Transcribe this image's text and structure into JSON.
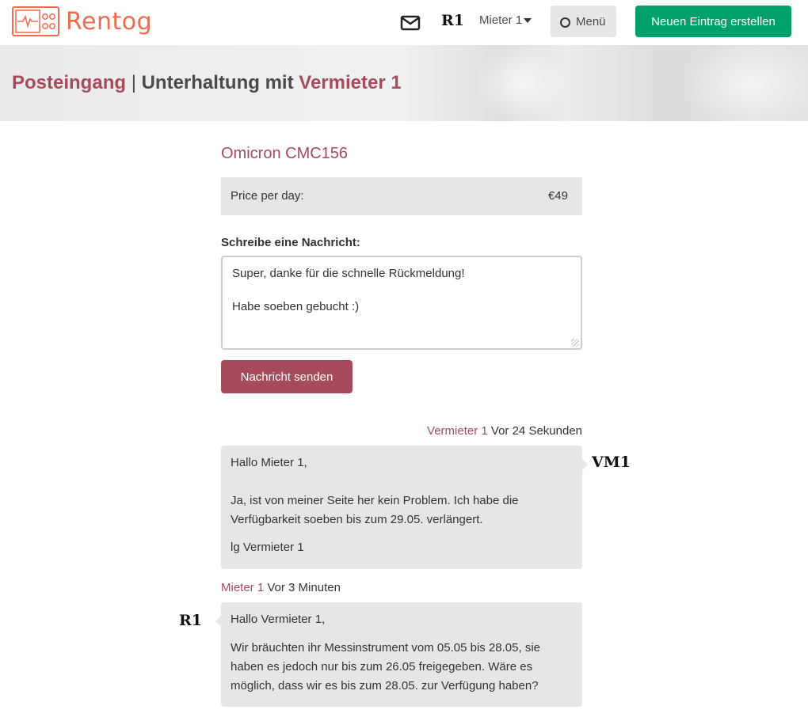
{
  "header": {
    "logo_text": "Rentog",
    "logo_icon": "monitor-pulse-icon",
    "inbox_icon": "envelope-icon",
    "user_initials": "R1",
    "user_name": "Mieter 1",
    "menu_label": "Menü",
    "create_button": "Neuen Eintrag erstellen"
  },
  "banner": {
    "inbox_link": "Posteingang",
    "separator": "|",
    "conversation_prefix": "Unterhaltung mit",
    "partner_name": "Vermieter 1"
  },
  "listing": {
    "title": "Omicron CMC156",
    "price_label": "Price per day:",
    "price_value": "€49"
  },
  "composer": {
    "label": "Schreibe eine Nachricht:",
    "line1": "Super, danke für die schnelle Rückmeldung!",
    "line2": "Habe soeben gebucht :)",
    "send_button": "Nachricht senden"
  },
  "messages": [
    {
      "author": "Vermieter 1",
      "time": "Vor 24 Sekunden",
      "initials": "VM1",
      "lines": [
        "Hallo Mieter 1,",
        "Ja, ist von meiner Seite her kein Problem. Ich habe die Verfügbarkeit soeben bis zum 29.05. verlängert.",
        "lg Vermieter 1"
      ]
    },
    {
      "author": "Mieter 1",
      "time": "Vor 3 Minuten",
      "initials": "R1",
      "lines": [
        "Hallo Vermieter 1,",
        "Wir bräuchten ihr Messinstrument vom 05.05 bis 28.05, sie haben es jedoch nur bis zum 26.05 freigegeben. Wäre es möglich, dass wir es bis zum 28.05. zur Verfügung haben?"
      ]
    }
  ],
  "colors": {
    "brand_orange": "#ee6b4d",
    "accent": "#a64b5c",
    "primary_green": "#00a06b",
    "bubble_gray": "#e6e6e6"
  }
}
